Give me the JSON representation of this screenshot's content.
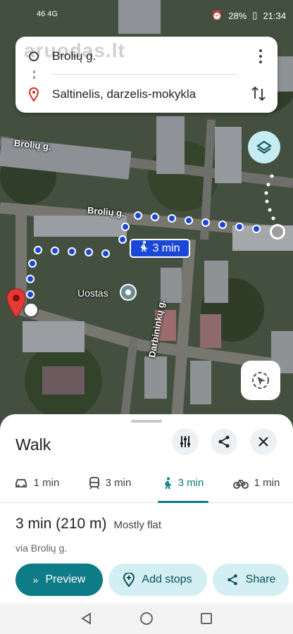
{
  "status": {
    "signal": "46 4G",
    "battery": "28%",
    "time": "21:34"
  },
  "search": {
    "watermark": "aruodas.lt",
    "origin": "Brolių g.",
    "destination": "Saltinelis, darzelis-mokykla"
  },
  "map": {
    "street1": "Brolių g.",
    "street2": "Brolių g.",
    "street3": "Darbininkų g.",
    "place": "Uostas",
    "badge_time": "3 min"
  },
  "sheet": {
    "title": "Walk",
    "modes": [
      {
        "icon": "car-icon",
        "label": "1 min"
      },
      {
        "icon": "transit-icon",
        "label": "3 min"
      },
      {
        "icon": "walk-icon",
        "label": "3 min",
        "active": true
      },
      {
        "icon": "bike-icon",
        "label": "1 min"
      }
    ],
    "summary_time": "3 min (210 m)",
    "summary_terrain": "Mostly flat",
    "via": "via Brolių g.",
    "preview_label": "Preview",
    "add_stops_label": "Add stops",
    "share_label": "Share"
  },
  "colors": {
    "accent": "#0e7c86",
    "route": "#1a47d6",
    "pin": "#e53935"
  }
}
